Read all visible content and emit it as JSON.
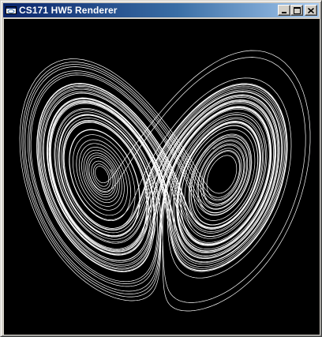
{
  "window": {
    "title": "CS171 HW5 Renderer",
    "icons": {
      "app": "app-window-icon",
      "minimize": "minimize-icon",
      "maximize": "maximize-icon",
      "close": "close-icon"
    }
  },
  "canvas": {
    "background": "#000000",
    "stroke": "#ffffff",
    "subject": "lorenz-attractor-icon"
  }
}
